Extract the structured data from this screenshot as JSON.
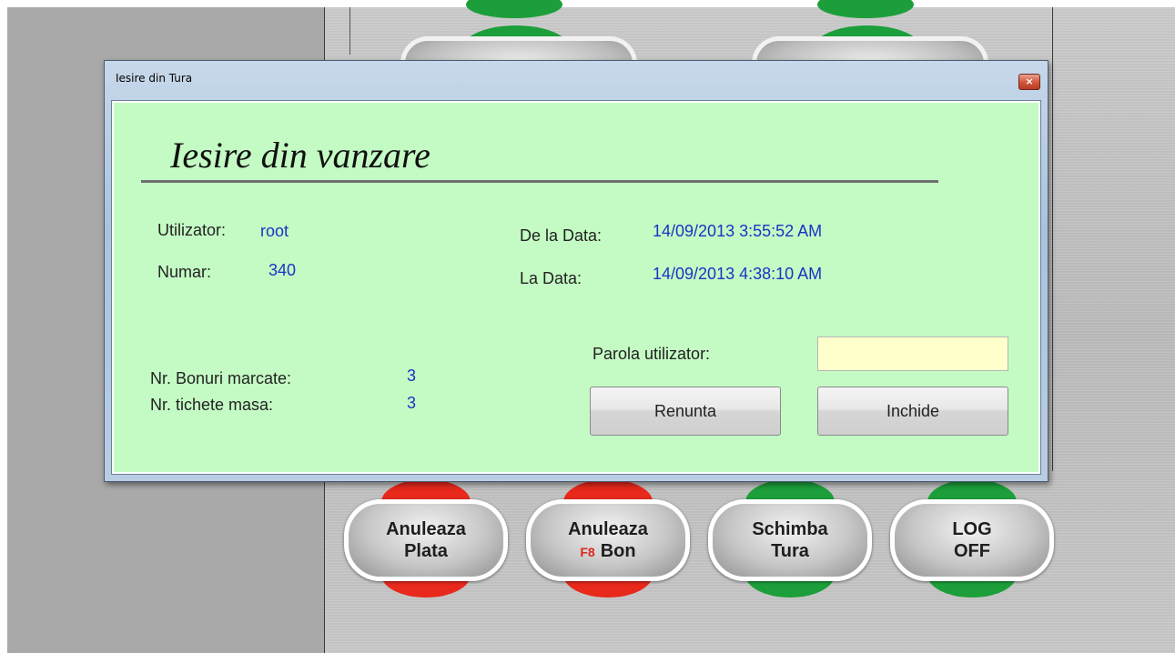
{
  "dialog": {
    "window_title": "Iesire din Tura",
    "close_symbol": "×",
    "heading": "Iesire din vanzare",
    "utilizator_label": "Utilizator:",
    "utilizator_value": "root",
    "numar_label": "Numar:",
    "numar_value": "340",
    "de_la_data_label": "De la Data:",
    "de_la_data_value": "14/09/2013 3:55:52 AM",
    "la_data_label": "La Data:",
    "la_data_value": "14/09/2013 4:38:10 AM",
    "nr_bonuri_label": "Nr. Bonuri marcate:",
    "nr_bonuri_value": "3",
    "nr_tichete_label": "Nr. tichete masa:",
    "nr_tichete_value": "3",
    "parola_label": "Parola utilizator:",
    "parola_value": "",
    "renunta_label": "Renunta",
    "inchide_label": "Inchide"
  },
  "background_buttons": [
    {
      "line1": "Anuleaza",
      "line2": "Plata",
      "fkey": "",
      "cap_color": "#e8291c"
    },
    {
      "line1": "Anuleaza",
      "line2": "Bon",
      "fkey": "F8",
      "cap_color": "#e8291c"
    },
    {
      "line1": "Schimba",
      "line2": "Tura",
      "fkey": "",
      "cap_color": "#1c9f3a"
    },
    {
      "line1": "LOG",
      "line2": "OFF",
      "fkey": "",
      "cap_color": "#1c9f3a"
    }
  ],
  "colors": {
    "dialog_client": "#c4fbc4",
    "value_text": "#1a33c4",
    "password_field": "#ffffcc"
  }
}
